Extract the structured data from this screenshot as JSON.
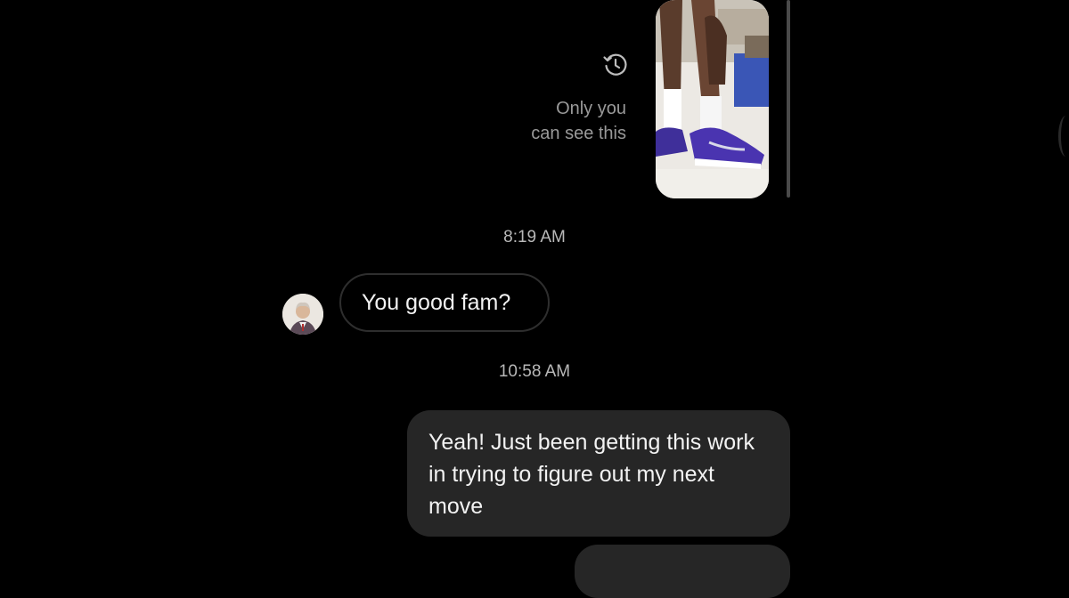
{
  "story_reply": {
    "shared_story_image": "basketball-shoes-photo",
    "visibility_icon": "history-clock-icon",
    "visibility_note": "Only you\ncan see this"
  },
  "timestamps": [
    "8:19 AM",
    "10:58 AM"
  ],
  "messages": [
    {
      "direction": "received",
      "avatar": "profile-photo",
      "text": "You good fam?"
    },
    {
      "direction": "sent",
      "text": "Yeah! Just been getting this work in trying to figure out my next move"
    }
  ],
  "colors": {
    "background": "#000000",
    "sent_bubble": "#262626",
    "received_bubble_border": "#2e2e2e",
    "secondary_text": "#9a9a9a",
    "timestamp_text": "#b8b8b8"
  }
}
